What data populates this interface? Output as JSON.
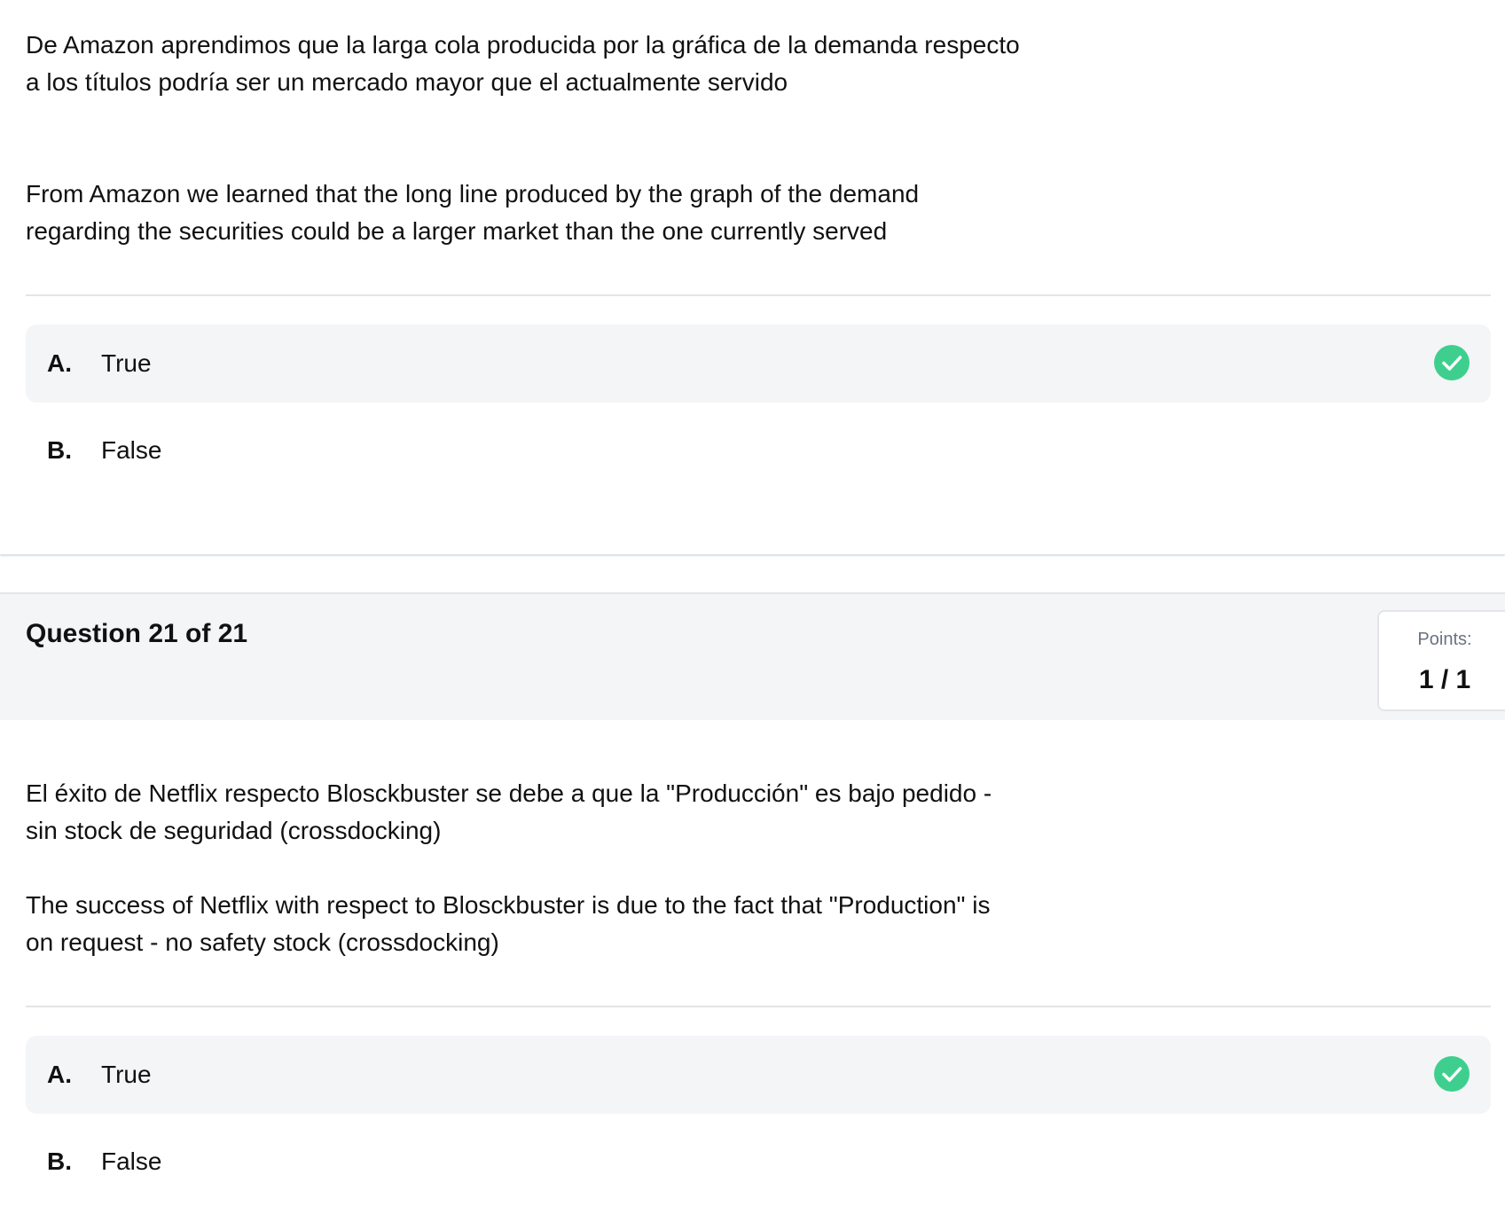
{
  "question20": {
    "text_es_line1": "De Amazon aprendimos que la larga cola producida por la gráfica de la demanda respecto",
    "text_es_line2": "a los títulos podría ser un mercado mayor que el actualmente servido",
    "text_en_line1": "From Amazon we learned that the long line produced by the graph of the demand",
    "text_en_line2": "regarding the securities could be a larger market than the one currently served",
    "options": [
      {
        "letter": "A.",
        "label": "True",
        "selected": true,
        "correct": true
      },
      {
        "letter": "B.",
        "label": "False",
        "selected": false
      }
    ]
  },
  "question21": {
    "title": "Question 21 of 21",
    "points_label": "Points:",
    "points_value": "1 / 1",
    "text_es_line1": "El éxito de Netflix respecto Blosckbuster se debe a que la \"Producción\" es bajo pedido -",
    "text_es_line2": "sin stock de seguridad (crossdocking)",
    "text_en_line1": "The success of Netflix with respect to Blosckbuster is due to the fact that \"Production\" is",
    "text_en_line2": "on request - no safety stock (crossdocking)",
    "options": [
      {
        "letter": "A.",
        "label": "True",
        "selected": true,
        "correct": true
      },
      {
        "letter": "B.",
        "label": "False",
        "selected": false
      }
    ]
  },
  "colors": {
    "selected_bg": "#f4f5f7",
    "check_green": "#3ecf8e",
    "divider": "#e3e5e8"
  },
  "icons": {
    "correct": "check-circle-icon"
  }
}
